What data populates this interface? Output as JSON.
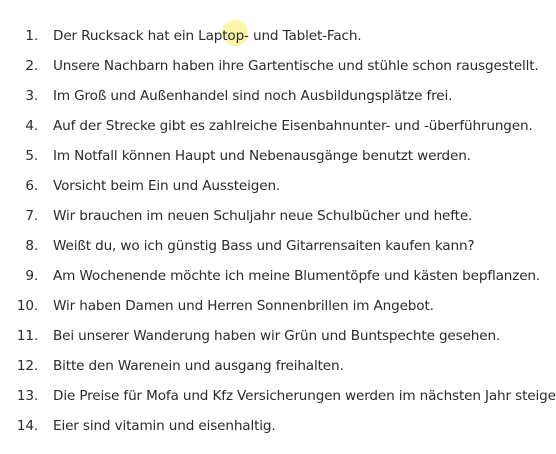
{
  "sentences": [
    {
      "number": "1.",
      "text": "Der Rucksack hat ein Laptop- und Tablet-Fach."
    },
    {
      "number": "2.",
      "text": "Unsere Nachbarn haben ihre Gartentische und stühle schon rausgestellt."
    },
    {
      "number": "3.",
      "text": "Im Groß und Außenhandel sind noch Ausbildungsplätze frei."
    },
    {
      "number": "4.",
      "text": "Auf der Strecke gibt es zahlreiche Eisenbahnunter- und -überführungen."
    },
    {
      "number": "5.",
      "text": "Im Notfall können Haupt und Nebenausgänge benutzt werden."
    },
    {
      "number": "6.",
      "text": "Vorsicht beim Ein und Aussteigen."
    },
    {
      "number": "7.",
      "text": "Wir brauchen im neuen Schuljahr neue Schulbücher und hefte."
    },
    {
      "number": "8.",
      "text": "Weißt du, wo ich günstig Bass und Gitarrensaiten kaufen kann?"
    },
    {
      "number": "9.",
      "text": "Am Wochenende möchte ich meine Blumentöpfe und kästen bepflanzen."
    },
    {
      "number": "10.",
      "text": "Wir haben Damen und Herren Sonnenbrillen im Angebot."
    },
    {
      "number": "11.",
      "text": "Bei unserer Wanderung haben wir Grün und Buntspechte gesehen."
    },
    {
      "number": "12.",
      "text": "Bitte den Warenein und ausgang freihalten."
    },
    {
      "number": "13.",
      "text": "Die Preise für Mofa und Kfz Versicherungen werden im nächsten Jahr steigen."
    },
    {
      "number": "14.",
      "text": "Eier sind vitamin und eisenhaltig."
    }
  ]
}
